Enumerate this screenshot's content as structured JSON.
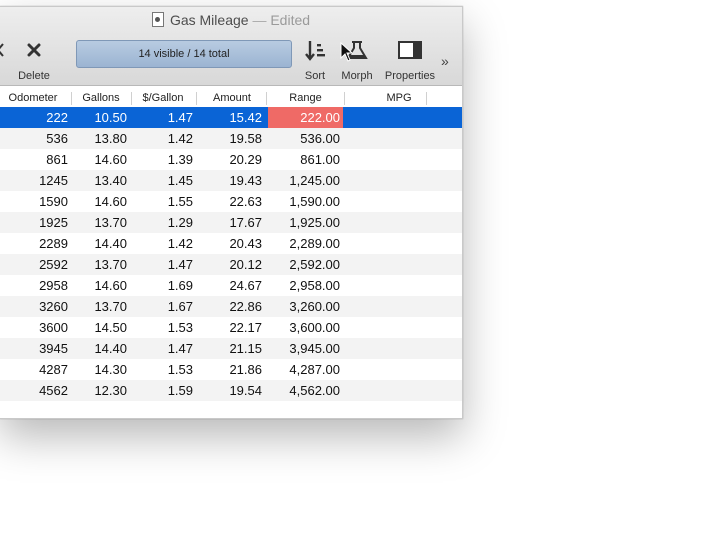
{
  "window": {
    "title": "Gas Mileage",
    "status": "Edited"
  },
  "toolbar": {
    "cut_label": "rt",
    "delete_label": "Delete",
    "filter_text": "14 visible / 14 total",
    "sort_label": "Sort",
    "morph_label": "Morph",
    "properties_label": "Properties",
    "overflow": "»"
  },
  "columns": [
    "Odometer",
    "Gallons",
    "$/Gallon",
    "Amount",
    "Range",
    "MPG"
  ],
  "rows": [
    {
      "odometer": "222",
      "gallons": "10.50",
      "price": "1.47",
      "amount": "15.42",
      "range": "222.00",
      "mpg": ""
    },
    {
      "odometer": "536",
      "gallons": "13.80",
      "price": "1.42",
      "amount": "19.58",
      "range": "536.00",
      "mpg": ""
    },
    {
      "odometer": "861",
      "gallons": "14.60",
      "price": "1.39",
      "amount": "20.29",
      "range": "861.00",
      "mpg": ""
    },
    {
      "odometer": "1245",
      "gallons": "13.40",
      "price": "1.45",
      "amount": "19.43",
      "range": "1,245.00",
      "mpg": ""
    },
    {
      "odometer": "1590",
      "gallons": "14.60",
      "price": "1.55",
      "amount": "22.63",
      "range": "1,590.00",
      "mpg": ""
    },
    {
      "odometer": "1925",
      "gallons": "13.70",
      "price": "1.29",
      "amount": "17.67",
      "range": "1,925.00",
      "mpg": ""
    },
    {
      "odometer": "2289",
      "gallons": "14.40",
      "price": "1.42",
      "amount": "20.43",
      "range": "2,289.00",
      "mpg": ""
    },
    {
      "odometer": "2592",
      "gallons": "13.70",
      "price": "1.47",
      "amount": "20.12",
      "range": "2,592.00",
      "mpg": ""
    },
    {
      "odometer": "2958",
      "gallons": "14.60",
      "price": "1.69",
      "amount": "24.67",
      "range": "2,958.00",
      "mpg": ""
    },
    {
      "odometer": "3260",
      "gallons": "13.70",
      "price": "1.67",
      "amount": "22.86",
      "range": "3,260.00",
      "mpg": ""
    },
    {
      "odometer": "3600",
      "gallons": "14.50",
      "price": "1.53",
      "amount": "22.17",
      "range": "3,600.00",
      "mpg": ""
    },
    {
      "odometer": "3945",
      "gallons": "14.40",
      "price": "1.47",
      "amount": "21.15",
      "range": "3,945.00",
      "mpg": ""
    },
    {
      "odometer": "4287",
      "gallons": "14.30",
      "price": "1.53",
      "amount": "21.86",
      "range": "4,287.00",
      "mpg": ""
    },
    {
      "odometer": "4562",
      "gallons": "12.30",
      "price": "1.59",
      "amount": "19.54",
      "range": "4,562.00",
      "mpg": ""
    }
  ],
  "colors": {
    "selection": "#0a64d6",
    "range_highlight": "#ef6a66"
  }
}
